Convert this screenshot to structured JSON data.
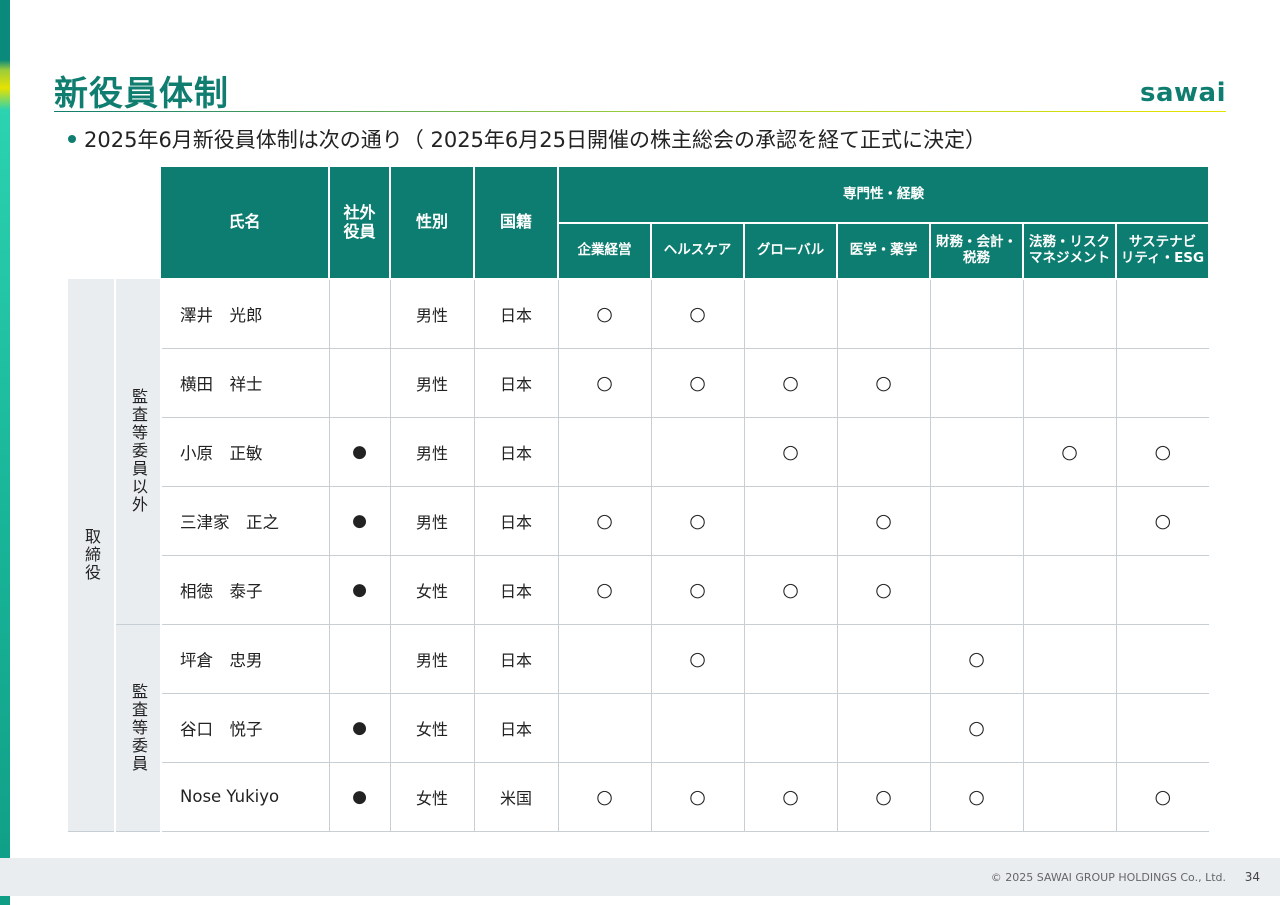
{
  "header": {
    "title": "新役員体制",
    "logo": "sawai",
    "bullet": "2025年6月新役員体制は次の通り（ 2025年6月25日開催の株主総会の承認を経て正式に決定）"
  },
  "table": {
    "col_name": "氏名",
    "col_outside": "社外\n役員",
    "col_gender": "性別",
    "col_nationality": "国籍",
    "group_expertise": "専門性・経験",
    "expertise": [
      "企業経営",
      "ヘルスケア",
      "グローバル",
      "医学・薬学",
      "財務・会計・\n税務",
      "法務・リスク\nマネジメント",
      "サステナビ\nリティ・ESG"
    ],
    "side_outer": "取締役",
    "side_group1": "監査等委員以外",
    "side_group2": "監査等委員",
    "rows": [
      {
        "name": "澤井　光郎",
        "outside": "",
        "gender": "男性",
        "nationality": "日本",
        "marks": [
          "○",
          "○",
          "",
          "",
          "",
          "",
          ""
        ]
      },
      {
        "name": "横田　祥士",
        "outside": "",
        "gender": "男性",
        "nationality": "日本",
        "marks": [
          "○",
          "○",
          "○",
          "○",
          "",
          "",
          ""
        ]
      },
      {
        "name": "小原　正敏",
        "outside": "●",
        "gender": "男性",
        "nationality": "日本",
        "marks": [
          "",
          "",
          "○",
          "",
          "",
          "○",
          "○"
        ]
      },
      {
        "name": "三津家　正之",
        "outside": "●",
        "gender": "男性",
        "nationality": "日本",
        "marks": [
          "○",
          "○",
          "",
          "○",
          "",
          "",
          "○"
        ]
      },
      {
        "name": "相徳　泰子",
        "outside": "●",
        "gender": "女性",
        "nationality": "日本",
        "marks": [
          "○",
          "○",
          "○",
          "○",
          "",
          "",
          ""
        ]
      },
      {
        "name": "坪倉　忠男",
        "outside": "",
        "gender": "男性",
        "nationality": "日本",
        "marks": [
          "",
          "○",
          "",
          "",
          "○",
          "",
          ""
        ]
      },
      {
        "name": "谷口　悦子",
        "outside": "●",
        "gender": "女性",
        "nationality": "日本",
        "marks": [
          "",
          "",
          "",
          "",
          "○",
          "",
          ""
        ]
      },
      {
        "name": "Nose Yukiyo",
        "outside": "●",
        "gender": "女性",
        "nationality": "米国",
        "marks": [
          "○",
          "○",
          "○",
          "○",
          "○",
          "",
          "○"
        ]
      }
    ]
  },
  "footer": {
    "copyright": "© 2025 SAWAI GROUP HOLDINGS Co., Ltd.",
    "page": "34"
  },
  "colors": {
    "brand_teal": "#0e7d71",
    "side_gray": "#e9edf0"
  }
}
